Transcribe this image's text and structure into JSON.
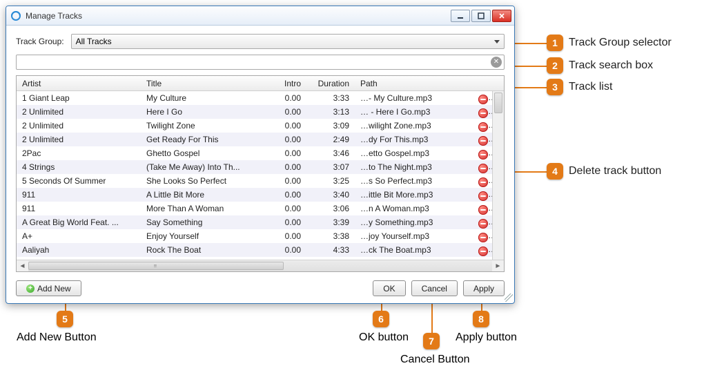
{
  "window": {
    "title": "Manage Tracks",
    "minimize_tip": "Minimize",
    "maximize_tip": "Maximize",
    "close_tip": "Close"
  },
  "trackgroup": {
    "label": "Track Group:",
    "selected": "All Tracks"
  },
  "search": {
    "placeholder": "",
    "value": ""
  },
  "columns": {
    "artist": "Artist",
    "title": "Title",
    "intro": "Intro",
    "duration": "Duration",
    "path": "Path"
  },
  "tracks": [
    {
      "artist": "1 Giant Leap",
      "title": "My Culture",
      "intro": "0.00",
      "duration": "3:33",
      "path": "…- My Culture.mp3"
    },
    {
      "artist": "2 Unlimited",
      "title": "Here I Go",
      "intro": "0.00",
      "duration": "3:13",
      "path": "… - Here I Go.mp3"
    },
    {
      "artist": "2 Unlimited",
      "title": "Twilight Zone",
      "intro": "0.00",
      "duration": "3:09",
      "path": "…wilight Zone.mp3"
    },
    {
      "artist": "2 Unlimited",
      "title": "Get Ready For This",
      "intro": "0.00",
      "duration": "2:49",
      "path": "…dy For This.mp3"
    },
    {
      "artist": "2Pac",
      "title": "Ghetto Gospel",
      "intro": "0.00",
      "duration": "3:46",
      "path": "…etto Gospel.mp3"
    },
    {
      "artist": "4 Strings",
      "title": "(Take Me Away) Into Th...",
      "intro": "0.00",
      "duration": "3:07",
      "path": "…to The Night.mp3"
    },
    {
      "artist": "5 Seconds Of Summer",
      "title": "She Looks So Perfect",
      "intro": "0.00",
      "duration": "3:25",
      "path": "…s So Perfect.mp3"
    },
    {
      "artist": "911",
      "title": "A Little Bit More",
      "intro": "0.00",
      "duration": "3:40",
      "path": "…ittle Bit More.mp3"
    },
    {
      "artist": "911",
      "title": "More Than A Woman",
      "intro": "0.00",
      "duration": "3:06",
      "path": "…n A Woman.mp3"
    },
    {
      "artist": "A Great Big World Feat. ...",
      "title": "Say Something",
      "intro": "0.00",
      "duration": "3:39",
      "path": "…y Something.mp3"
    },
    {
      "artist": "A+",
      "title": "Enjoy Yourself",
      "intro": "0.00",
      "duration": "3:38",
      "path": "…joy Yourself.mp3"
    },
    {
      "artist": "Aaliyah",
      "title": "Rock The Boat",
      "intro": "0.00",
      "duration": "4:33",
      "path": "…ck The Boat.mp3"
    }
  ],
  "buttons": {
    "add_new": "Add New",
    "ok": "OK",
    "cancel": "Cancel",
    "apply": "Apply"
  },
  "callouts": {
    "c1": "Track Group selector",
    "c2": "Track search box",
    "c3": "Track list",
    "c4": "Delete track button",
    "c5": "Add New Button",
    "c6": "OK button",
    "c7": "Cancel Button",
    "c8": "Apply button"
  }
}
